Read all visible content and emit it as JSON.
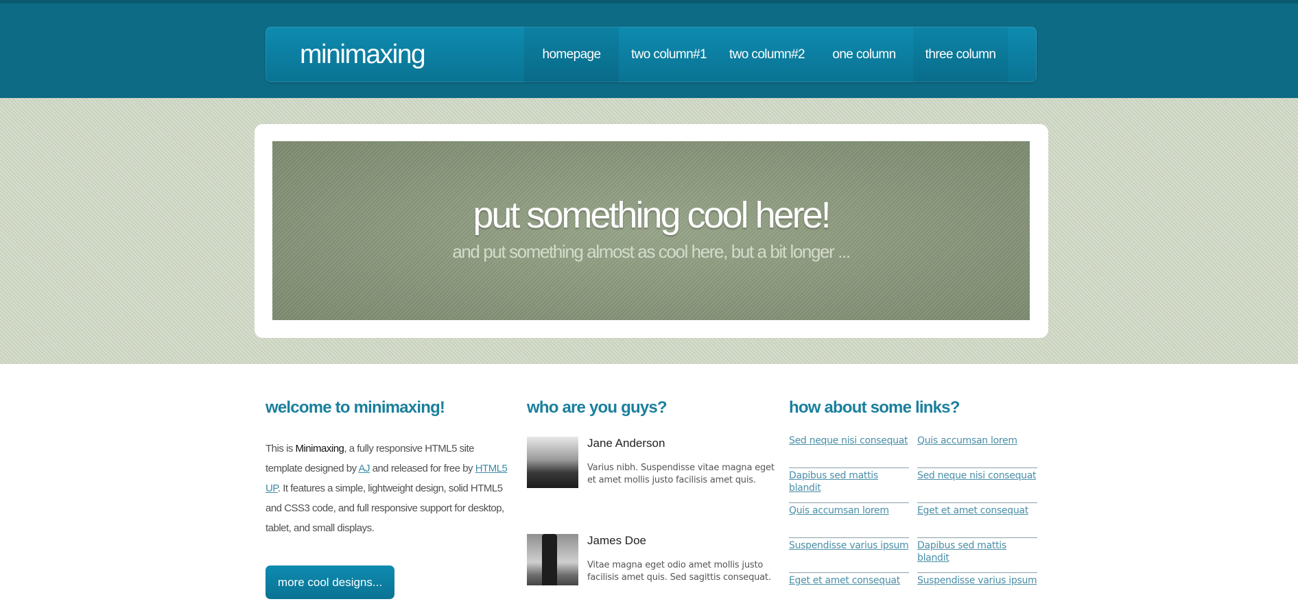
{
  "site": {
    "logo": "minimaxing"
  },
  "nav": {
    "items": [
      {
        "label": "homepage"
      },
      {
        "label": "two column#1"
      },
      {
        "label": "two column#2"
      },
      {
        "label": "one column"
      },
      {
        "label": "three column"
      }
    ]
  },
  "banner": {
    "title": "put something cool here!",
    "subtitle": "and put something almost as cool here, but a bit longer ..."
  },
  "welcome": {
    "title": "welcome to minimaxing!",
    "text_1": "This is ",
    "brand": "Minimaxing",
    "text_2": ", a fully responsive HTML5 site template designed by ",
    "author_link": "AJ",
    "text_3": " and released for free by ",
    "publisher_link": "HTML5 UP",
    "text_4": ". It features a simple, lightweight design, solid HTML5 and CSS3 code, and full responsive support for desktop, tablet, and small displays.",
    "button": "more cool designs..."
  },
  "team": {
    "title": "who are you guys?",
    "people": [
      {
        "name": "Jane Anderson",
        "desc": "Varius nibh. Suspendisse vitae magna eget et amet mollis justo facilisis amet quis."
      },
      {
        "name": "James Doe",
        "desc": "Vitae magna eget odio amet mollis justo facilisis amet quis. Sed sagittis consequat."
      }
    ]
  },
  "links": {
    "title": "how about some links?",
    "left": [
      "Sed neque nisi consequat",
      "Dapibus sed mattis blandit",
      "Quis accumsan lorem",
      "Suspendisse varius ipsum",
      "Eget et amet consequat"
    ],
    "right": [
      "Quis accumsan lorem",
      "Sed neque nisi consequat",
      "Eget et amet consequat",
      "Dapibus sed mattis blandit",
      "Suspendisse varius ipsum"
    ]
  }
}
